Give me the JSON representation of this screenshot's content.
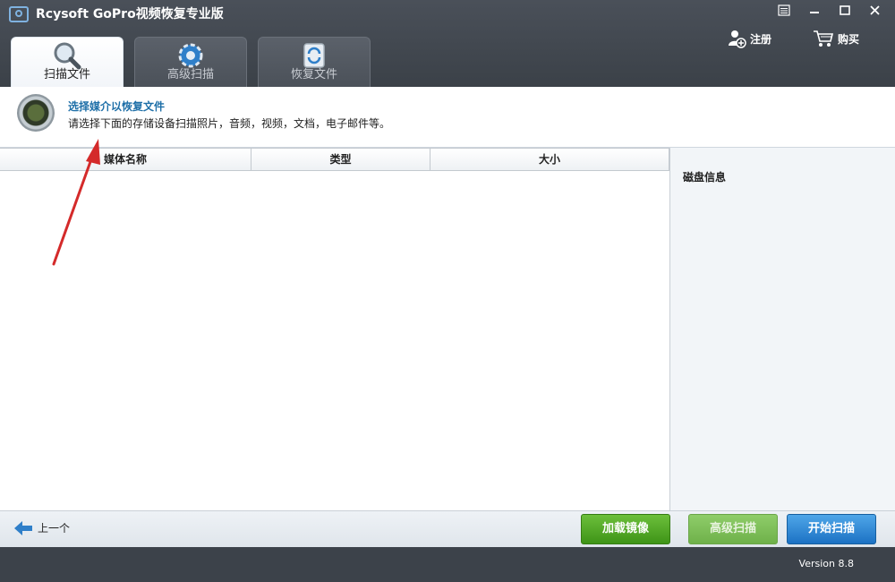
{
  "app": {
    "title": "Rcysoft GoPro视频恢复专业版",
    "register_label": "注册",
    "buy_label": "购买"
  },
  "tabs": [
    {
      "label": "扫描文件",
      "icon": "magnifier-icon",
      "active": true
    },
    {
      "label": "高级扫描",
      "icon": "gear-icon",
      "active": false
    },
    {
      "label": "恢复文件",
      "icon": "recycle-icon",
      "active": false
    }
  ],
  "info": {
    "title": "选择媒介以恢复文件",
    "subtitle": "请选择下面的存储设备扫描照片，音频，视频，文档，电子邮件等。"
  },
  "table": {
    "columns": [
      "媒体名称",
      "类型",
      "大小"
    ]
  },
  "side_panel": {
    "title": "磁盘信息"
  },
  "bottom": {
    "prev_label": "上一个",
    "load_image_label": "加载镜像",
    "advanced_scan_label": "高级扫描",
    "start_scan_label": "开始扫描"
  },
  "status": {
    "version": "Version 8.8"
  },
  "colors": {
    "accent_blue": "#1e6fa8",
    "green_button": "#4ea325",
    "blue_button": "#2a84d6",
    "annotation_arrow": "#d42a2a"
  }
}
